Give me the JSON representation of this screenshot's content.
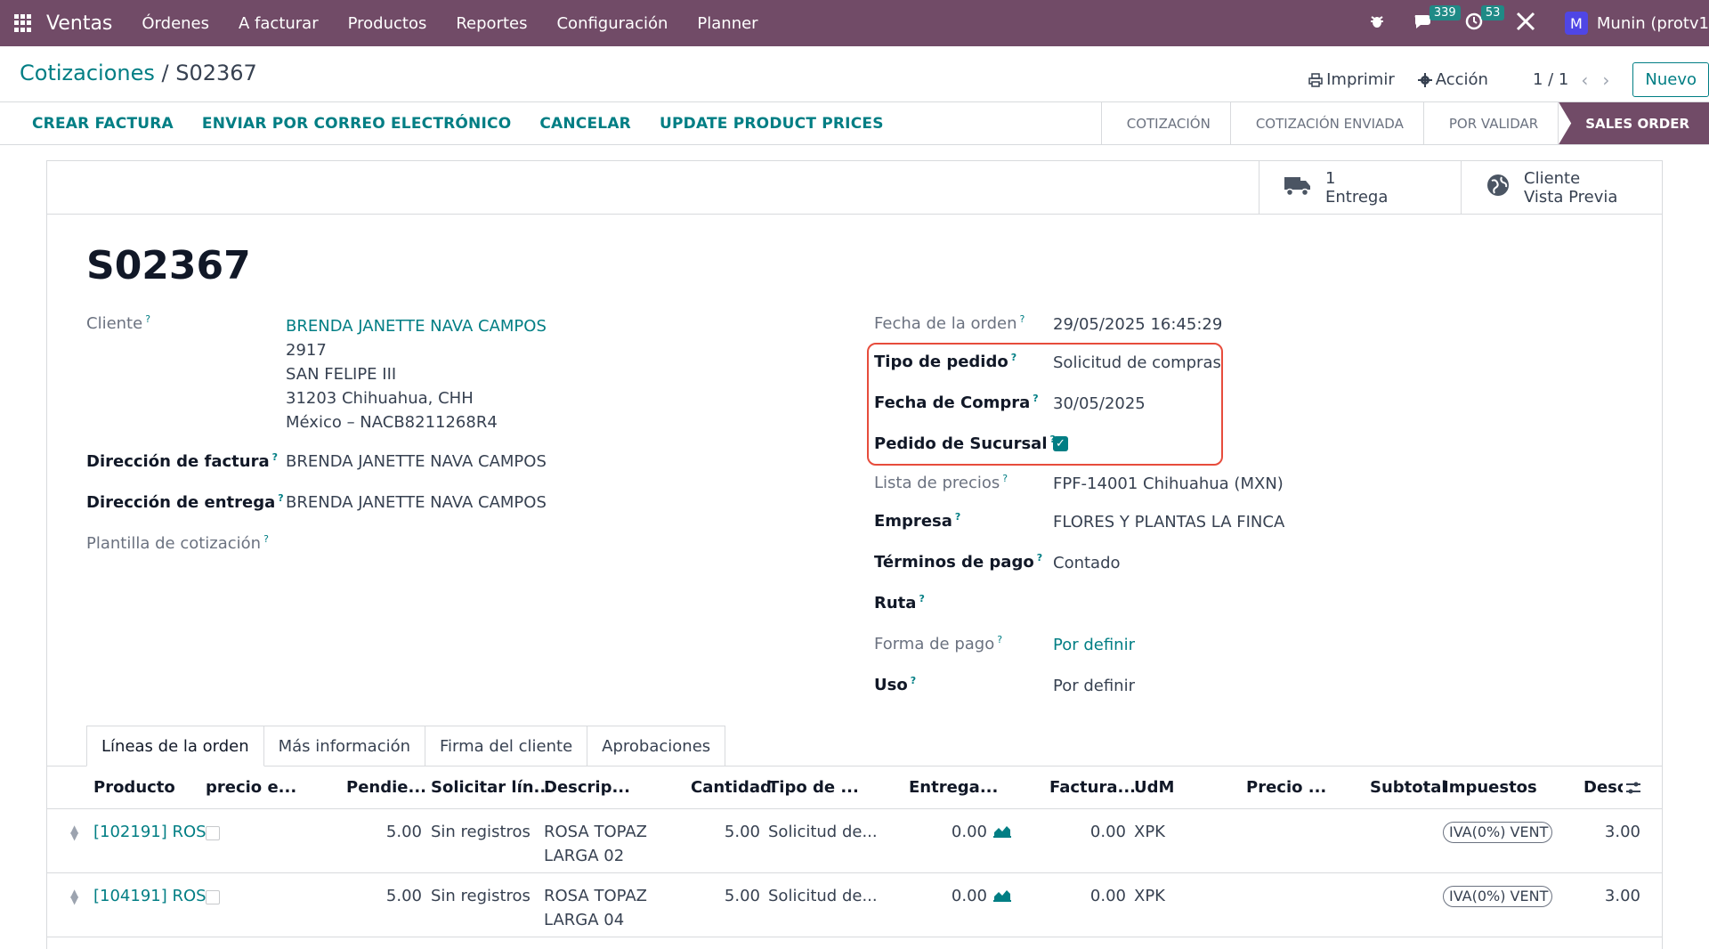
{
  "nav": {
    "brand": "Ventas",
    "menu": [
      "Órdenes",
      "A facturar",
      "Productos",
      "Reportes",
      "Configuración",
      "Planner"
    ],
    "messages_count": "339",
    "activities_count": "53",
    "avatar_letter": "M",
    "user": "Munin (protv1"
  },
  "breadcrumb": {
    "parent": "Cotizaciones",
    "sep": "/",
    "current": "S02367"
  },
  "control": {
    "print": "Imprimir",
    "action": "Acción",
    "pager": "1 / 1",
    "new": "Nuevo"
  },
  "actions": [
    "CREAR FACTURA",
    "ENVIAR POR CORREO ELECTRÓNICO",
    "CANCELAR",
    "UPDATE PRODUCT PRICES"
  ],
  "stages": [
    {
      "label": "COTIZACIÓN",
      "active": false
    },
    {
      "label": "COTIZACIÓN ENVIADA",
      "active": false
    },
    {
      "label": "POR VALIDAR",
      "active": false
    },
    {
      "label": "SALES ORDER",
      "active": true
    }
  ],
  "smart_buttons": {
    "delivery": {
      "count": "1",
      "label": "Entrega"
    },
    "preview": {
      "line1": "Cliente",
      "line2": "Vista Previa"
    }
  },
  "record": {
    "name": "S02367",
    "left_fields": {
      "cliente": {
        "label": "Cliente",
        "name": "BRENDA JANETTE NAVA CAMPOS",
        "address": [
          "2917",
          "SAN FELIPE III",
          "31203 Chihuahua, CHH",
          "México – NACB8211268R4"
        ]
      },
      "dir_factura": {
        "label": "Dirección de factura",
        "value": "BRENDA JANETTE NAVA CAMPOS"
      },
      "dir_entrega": {
        "label": "Dirección de entrega",
        "value": "BRENDA JANETTE NAVA CAMPOS"
      },
      "plantilla": {
        "label": "Plantilla de cotización",
        "value": ""
      }
    },
    "right_fields": {
      "fecha_orden": {
        "label": "Fecha de la orden",
        "value": "29/05/2025 16:45:29"
      },
      "tipo_pedido": {
        "label": "Tipo de pedido",
        "value": "Solicitud de compras"
      },
      "fecha_compra": {
        "label": "Fecha de Compra",
        "value": "30/05/2025"
      },
      "pedido_sucursal": {
        "label": "Pedido de Sucursal",
        "checked": true
      },
      "lista_precios": {
        "label": "Lista de precios",
        "value": "FPF-14001 Chihuahua (MXN)"
      },
      "empresa": {
        "label": "Empresa",
        "value": "FLORES Y PLANTAS LA FINCA"
      },
      "terminos": {
        "label": "Términos de pago",
        "value": "Contado"
      },
      "ruta": {
        "label": "Ruta",
        "value": ""
      },
      "forma_pago": {
        "label": "Forma de pago",
        "value": "Por definir"
      },
      "uso": {
        "label": "Uso",
        "value": "Por definir"
      }
    }
  },
  "tabs": [
    {
      "label": "Líneas de la orden",
      "active": true
    },
    {
      "label": "Más información",
      "active": false
    },
    {
      "label": "Firma del cliente",
      "active": false
    },
    {
      "label": "Aprobaciones",
      "active": false
    }
  ],
  "table": {
    "headers": [
      "Producto",
      "precio e...",
      "Pendie...",
      "Solicitar lín...",
      "Descrip...",
      "Cantidad",
      "Tipo de ...",
      "Entrega...",
      "Factura...",
      "UdM",
      "Precio ...",
      "Subtotal",
      "Impuestos",
      "Desc"
    ],
    "rows": [
      {
        "producto": "[102191] ROS",
        "pendiente": "5.00",
        "solicitar": "Sin registros",
        "desc1": "ROSA TOPAZ",
        "desc2": "LARGA 02",
        "cantidad": "5.00",
        "tipo": "Solicitud de...",
        "entregado": "0.00",
        "facturado": "0.00",
        "udm": "XPK",
        "impuestos": "IVA(0%) VENT",
        "desc": "3.00"
      },
      {
        "producto": "[104191] ROS",
        "pendiente": "5.00",
        "solicitar": "Sin registros",
        "desc1": "ROSA TOPAZ",
        "desc2": "LARGA 04",
        "cantidad": "5.00",
        "tipo": "Solicitud de...",
        "entregado": "0.00",
        "facturado": "0.00",
        "udm": "XPK",
        "impuestos": "IVA(0%) VENT",
        "desc": "3.00"
      }
    ]
  }
}
